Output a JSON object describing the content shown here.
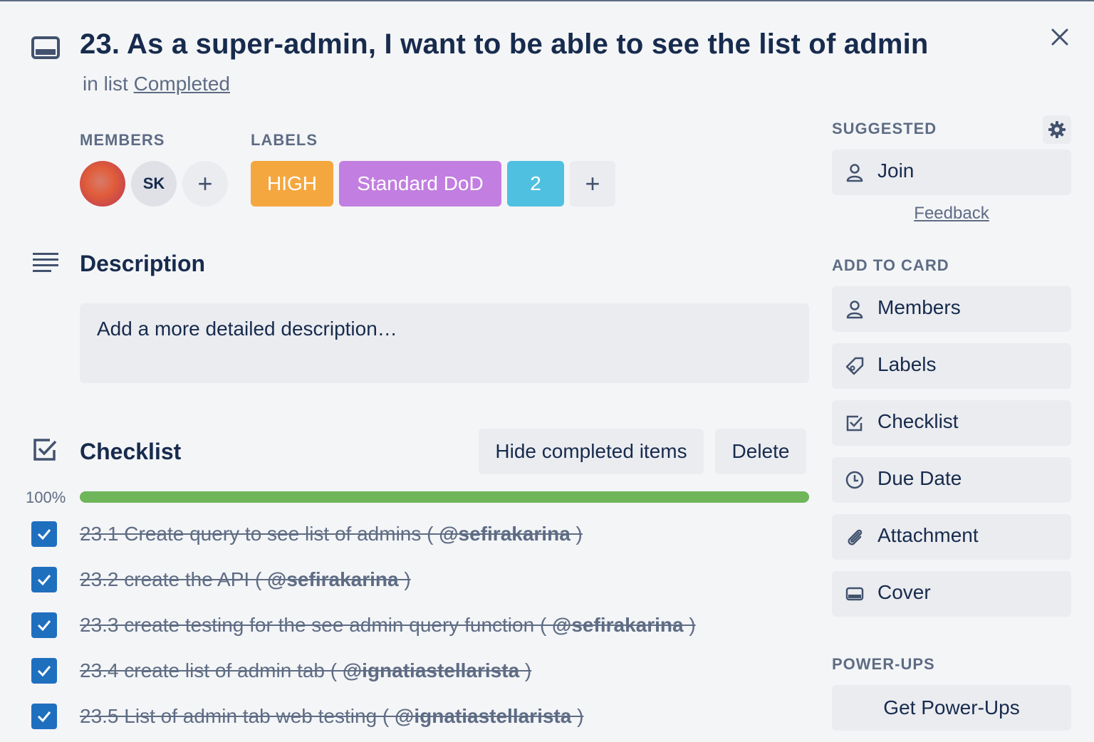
{
  "card": {
    "title": "23. As a super-admin, I want to be able to see the list of admin",
    "in_list_prefix": "in list",
    "list_name": "Completed"
  },
  "members": {
    "heading": "MEMBERS",
    "avatars": [
      {
        "initials": "",
        "kind": "photo"
      },
      {
        "initials": "SK",
        "kind": "initials"
      }
    ],
    "add_symbol": "+"
  },
  "labels": {
    "heading": "LABELS",
    "items": [
      {
        "text": "HIGH",
        "color": "#f5a73f"
      },
      {
        "text": "Standard DoD",
        "color": "#c27ee0"
      },
      {
        "text": "2",
        "color": "#50c0e0"
      }
    ],
    "add_symbol": "+"
  },
  "description": {
    "heading": "Description",
    "placeholder": "Add a more detailed description…"
  },
  "checklist": {
    "heading": "Checklist",
    "hide_button": "Hide completed items",
    "delete_button": "Delete",
    "progress_label": "100%",
    "progress": 1.0,
    "progress_color": "#6fb55a",
    "items": [
      {
        "text": "23.1 Create query to see list of admins ( ",
        "mention": "@sefirakarina",
        "suffix": " )",
        "checked": true
      },
      {
        "text": "23.2 create the API ( ",
        "mention": "@sefirakarina",
        "suffix": " )",
        "checked": true
      },
      {
        "text": "23.3 create testing for the see admin query function ( ",
        "mention": "@sefirakarina",
        "suffix": " )",
        "checked": true
      },
      {
        "text": "23.4 create list of admin tab ( ",
        "mention": "@ignatiastellarista",
        "suffix": " )",
        "checked": true
      },
      {
        "text": "23.5 List of admin tab web testing ( ",
        "mention": "@ignatiastellarista",
        "suffix": " )",
        "checked": true
      }
    ]
  },
  "sidebar": {
    "suggested_heading": "SUGGESTED",
    "join_label": "Join",
    "feedback_label": "Feedback",
    "add_to_card_heading": "ADD TO CARD",
    "add_items": [
      {
        "label": "Members",
        "icon": "person-icon"
      },
      {
        "label": "Labels",
        "icon": "tag-icon"
      },
      {
        "label": "Checklist",
        "icon": "checklist-icon"
      },
      {
        "label": "Due Date",
        "icon": "clock-icon"
      },
      {
        "label": "Attachment",
        "icon": "paperclip-icon"
      },
      {
        "label": "Cover",
        "icon": "cover-icon"
      }
    ],
    "power_ups_heading": "POWER-UPS",
    "get_power_ups_label": "Get Power-Ups"
  },
  "colors": {
    "accent_blue": "#1f6fbf",
    "text_primary": "#172b4d",
    "text_muted": "#5e6c84",
    "background": "#f4f5f7"
  }
}
